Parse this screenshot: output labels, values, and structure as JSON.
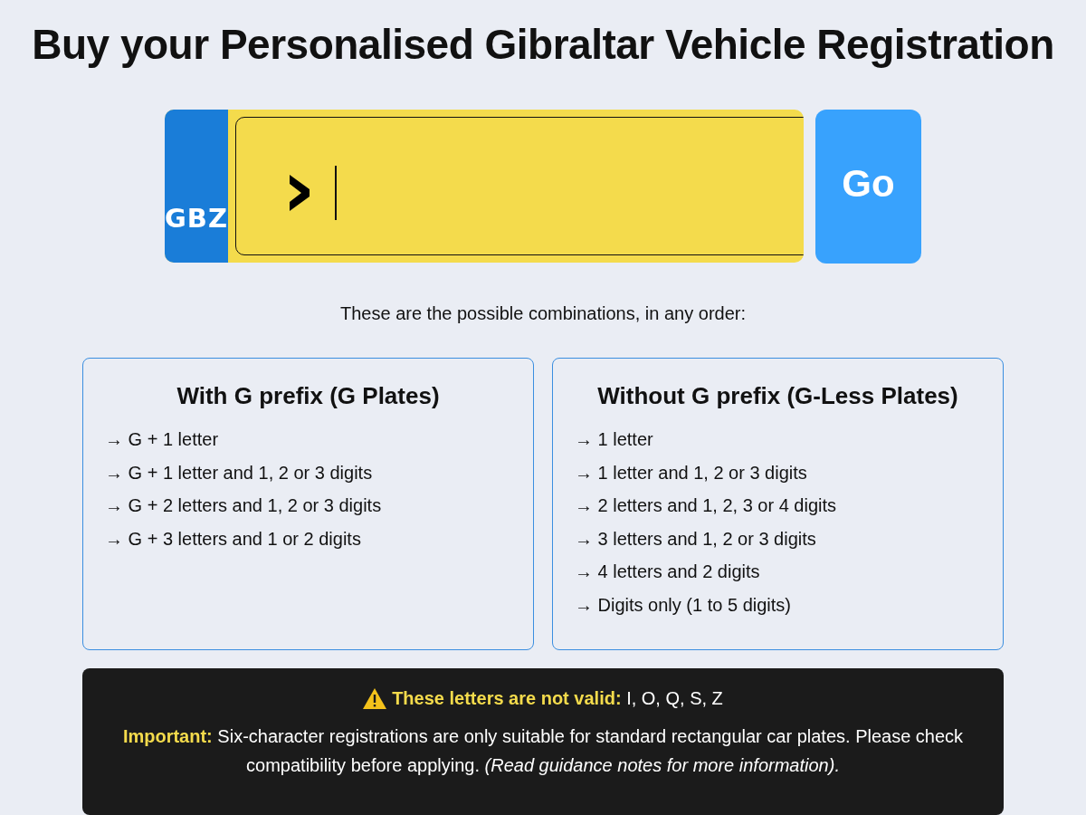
{
  "title": "Buy your Personalised Gibraltar Vehicle Registration",
  "plate": {
    "country_code": "GBZ"
  },
  "go_button": "Go",
  "intro": "These are the possible combinations, in any order:",
  "cards": [
    {
      "title": "With G prefix (G Plates)",
      "items": [
        "→ G + 1 letter",
        "→ G + 1 letter and 1, 2 or 3 digits",
        "→ G + 2 letters and 1, 2 or 3 digits",
        "→ G + 3 letters and 1 or 2 digits"
      ]
    },
    {
      "title": "Without G prefix (G-Less Plates)",
      "items": [
        "→ 1 letter",
        "→ 1 letter and 1, 2 or 3 digits",
        "→ 2 letters and 1, 2, 3 or 4 digits",
        "→ 3 letters and 1, 2 or 3 digits",
        "→ 4 letters and 2 digits",
        "→ Digits only (1 to 5 digits)"
      ]
    }
  ],
  "notice": {
    "warning": "**These letters are not valid:** I, O, Q, S, Z",
    "important": "**Important:** Six-character registrations are only suitable for standard rectangular car plates. Please check compatibility before applying. *(Read guidance notes for more information).*"
  }
}
